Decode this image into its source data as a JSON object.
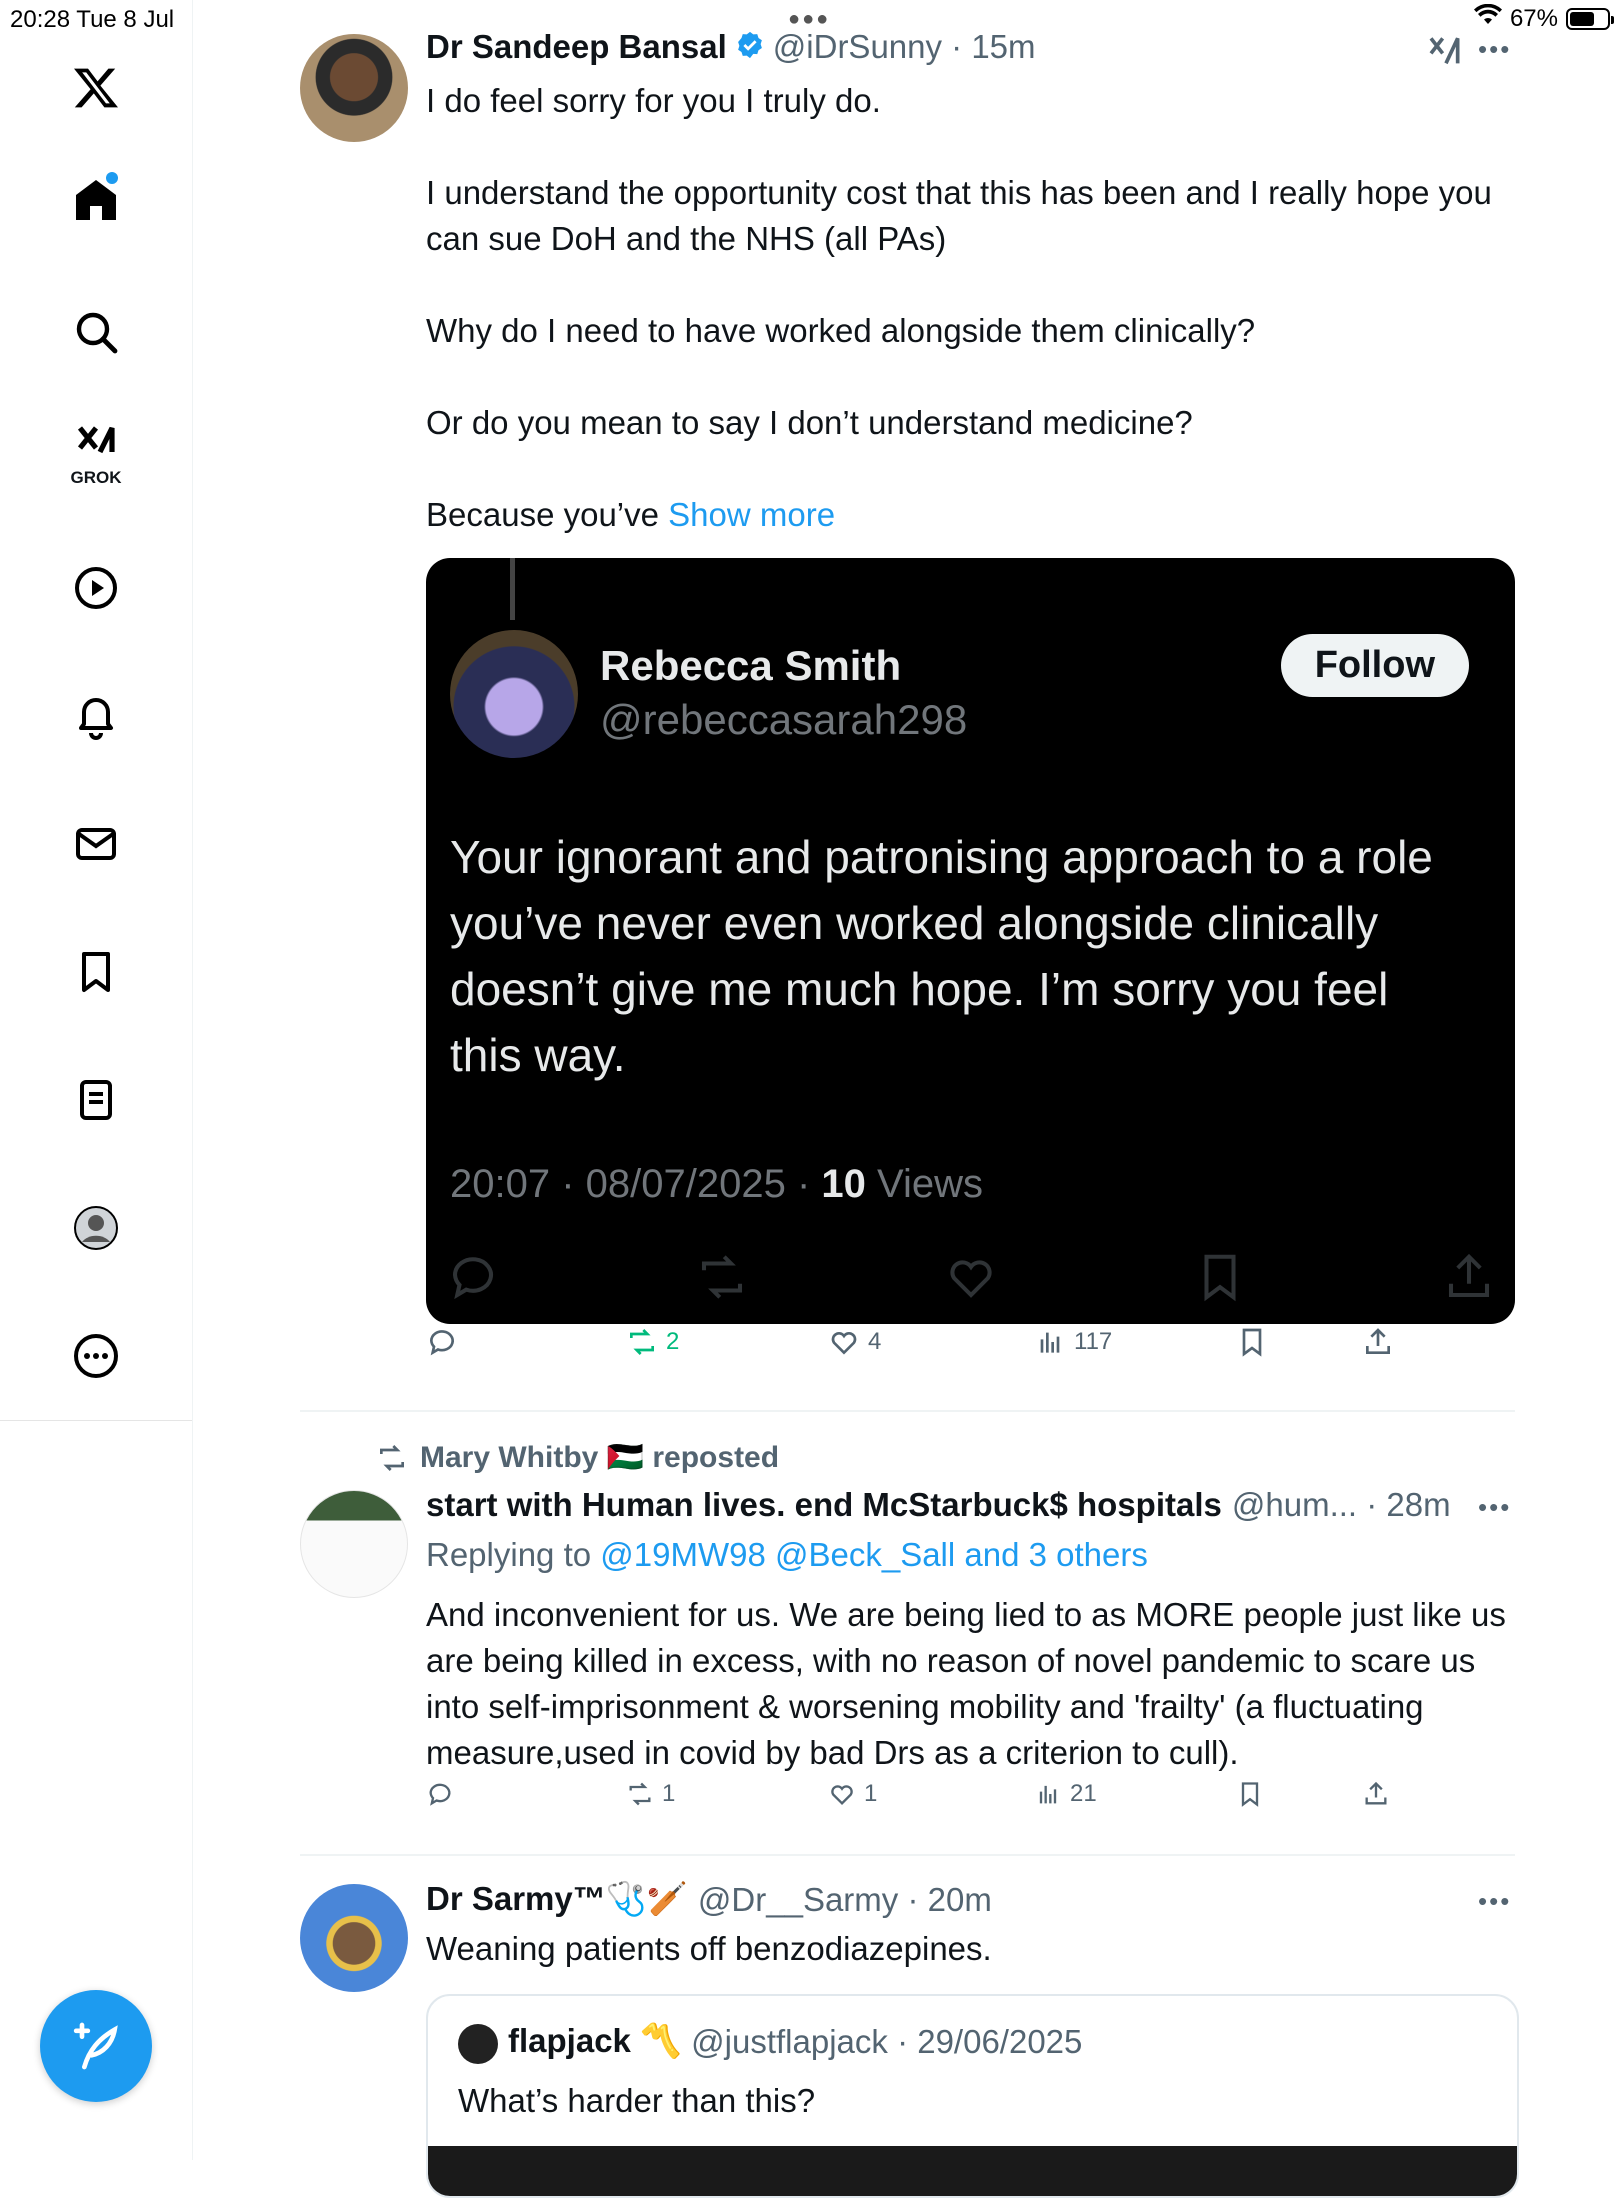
{
  "status_bar": {
    "time_date": "20:28   Tue 8 Jul",
    "battery": "67%",
    "battery_level": 0.67
  },
  "nav": {
    "items": [
      "home-icon",
      "search-icon",
      "grok-icon",
      "video-icon",
      "notifications-icon",
      "messages-icon",
      "bookmarks-icon",
      "lists-icon",
      "profile-icon",
      "more-icon"
    ],
    "grok_label": "GROK"
  },
  "posts": [
    {
      "name": "Dr Sandeep Bansal",
      "verified": true,
      "handle_time": "@iDrSunny · 15m",
      "text": [
        "I do feel sorry for you I truly do.",
        "I understand the opportunity cost that this has been and I really hope you can sue DoH and the NHS (all PAs)",
        "Why do I need to have worked alongside them clinically?",
        "Or do you mean to say I don’t understand medicine?",
        "Because you’ve"
      ],
      "show_more": "Show more",
      "embedded": {
        "name": "Rebecca Smith",
        "handle": "@rebeccasarah298",
        "follow": "Follow",
        "text": "Your ignorant and patronising approach to a role you’ve never even worked alongside clinically doesn’t give me much hope. I’m sorry you feel this way.",
        "timestamp": "20:07 · 08/07/2025 · ",
        "views_count": "10",
        "views_label": " Views"
      },
      "stats": {
        "replies": "",
        "reposts": "2",
        "likes": "4",
        "views": "117"
      }
    },
    {
      "repost_by": "Mary Whitby 🇵🇸 reposted",
      "name": "start with Human lives. end McStarbuck$ hospitals",
      "handle_time": "@hum... · 28m",
      "replying_to_prefix": "Replying to ",
      "replying_to": "@19MW98 @Beck_Sall and 3 others",
      "text": "And inconvenient for us.  We are being lied to as MORE people just like us are being killed in excess, with no reason of novel pandemic to scare us into self-imprisonment & worsening mobility and 'frailty' (a fluctuating measure,used in covid by bad Drs as a criterion to cull).",
      "stats": {
        "replies": "",
        "reposts": "1",
        "likes": "1",
        "views": "21"
      }
    },
    {
      "name": "Dr Sarmy™🩺🏏",
      "handle_time": "@Dr__Sarmy · 20m",
      "text": "Weaning patients off benzodiazepines.",
      "quote": {
        "name": "flapjack 〽️",
        "handle_time": "@justflapjack · 29/06/2025",
        "text": "What’s harder than this?"
      }
    }
  ],
  "colors": {
    "accent": "#1d9bf0",
    "repost_green": "#00ba7c",
    "text": "#0f1419",
    "secondary": "#536471"
  }
}
